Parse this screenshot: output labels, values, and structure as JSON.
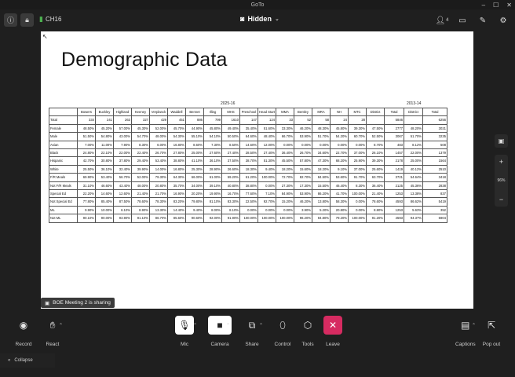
{
  "window": {
    "title": "GoTo",
    "controls": [
      "–",
      "☐",
      "✕"
    ]
  },
  "topbar": {
    "connection": "CH16",
    "view_mode": "Hidden",
    "attendees_count": "4"
  },
  "slide": {
    "title": "Demographic Data",
    "group_left": "2025-16",
    "group_right": "2013-14",
    "header": [
      "",
      "Bowers",
      "Buckley",
      "Highland",
      "Keeney",
      "Verplanck",
      "Waddell",
      "Bennet",
      "Illing",
      "MHS",
      "Preschool",
      "Head Start",
      "MMA",
      "Bentley",
      "MRA",
      "NH",
      "MTC",
      "District",
      "Total",
      "District",
      "Total"
    ],
    "rows": [
      [
        "Total",
        "334",
        "241",
        "263",
        "327",
        "429",
        "451",
        "886",
        "799",
        "1610",
        "147",
        "124",
        "33",
        "52",
        "58",
        "24",
        "28",
        "",
        "5846",
        "",
        "6256"
      ],
      [
        "Female",
        "48.50%",
        "45.20%",
        "57.00%",
        "45.30%",
        "52.00%",
        "45.70%",
        "44.90%",
        "45.80%",
        "49.40%",
        "35.40%",
        "51.60%",
        "33.30%",
        "46.20%",
        "48.30%",
        "45.80%",
        "39.30%",
        "47.50%",
        "2777",
        "48.20%",
        "3021"
      ],
      [
        "Male",
        "51.50%",
        "54.80%",
        "43.00%",
        "54.70%",
        "48.00%",
        "54.30%",
        "55.10%",
        "54.10%",
        "50.50%",
        "64.60%",
        "48.40%",
        "66.70%",
        "53.90%",
        "51.70%",
        "54.20%",
        "60.70%",
        "52.50%",
        "3067",
        "51.70%",
        "3235"
      ],
      [
        "Asian",
        "7.00%",
        "11.00%",
        "7.90%",
        "8.30%",
        "6.00%",
        "16.80%",
        "8.60%",
        "7.30%",
        "8.50%",
        "14.60%",
        "12.00%",
        "0.00%",
        "0.00%",
        "0.00%",
        "0.00%",
        "0.00%",
        "8.70%",
        "483",
        "8.12%",
        "508"
      ],
      [
        "Black",
        "24.80%",
        "22.10%",
        "22.00%",
        "22.40%",
        "26.70%",
        "27.80%",
        "25.00%",
        "27.60%",
        "27.40%",
        "28.50%",
        "27.40%",
        "36.40%",
        "26.70%",
        "34.60%",
        "22.70%",
        "37.00%",
        "26.10%",
        "1457",
        "22.00%",
        "1379"
      ],
      [
        "Hispanic",
        "42.70%",
        "30.80%",
        "37.80%",
        "29.40%",
        "53.40%",
        "38.80%",
        "41.10%",
        "36.10%",
        "37.50%",
        "38.70%",
        "51.30%",
        "45.50%",
        "57.80%",
        "47.30%",
        "68.20%",
        "25.90%",
        "39.30%",
        "2178",
        "25.00%",
        "1564"
      ],
      [
        "White",
        "25.50%",
        "36.10%",
        "32.40%",
        "39.90%",
        "14.00%",
        "16.80%",
        "25.30%",
        "28.90%",
        "26.60%",
        "18.30%",
        "9.40%",
        "18.20%",
        "15.60%",
        "18.20%",
        "9.10%",
        "37.00%",
        "25.60%",
        "1419",
        "40.12%",
        "2510"
      ],
      [
        "F/R Meals",
        "69.90%",
        "53.40%",
        "56.70%",
        "52.00%",
        "79.30%",
        "64.30%",
        "66.00%",
        "61.00%",
        "59.20%",
        "61.20%",
        "100.00%",
        "72.70%",
        "82.70%",
        "84.50%",
        "53.60%",
        "91.70%",
        "63.70%",
        "3721",
        "54.64%",
        "3418"
      ],
      [
        "Not F/R Meals",
        "31.10%",
        "46.60%",
        "43.40%",
        "48.00%",
        "20.80%",
        "35.70%",
        "34.00%",
        "39.10%",
        "40.80%",
        "38.80%",
        "0.00%",
        "27.30%",
        "17.30%",
        "15.50%",
        "46.40%",
        "8.30%",
        "36.40%",
        "2125",
        "45.36%",
        "2838"
      ],
      [
        "Special Ed",
        "22.20%",
        "14.60%",
        "12.60%",
        "21.40%",
        "21.70%",
        "16.90%",
        "20.20%",
        "19.90%",
        "16.70%",
        "77.60%",
        "7.10%",
        "84.90%",
        "53.90%",
        "86.20%",
        "41.70%",
        "100.00%",
        "21.40%",
        "1253",
        "13.38%",
        "837"
      ],
      [
        "Not Special Ed",
        "77.80%",
        "85.40%",
        "87.50%",
        "78.60%",
        "78.30%",
        "83.20%",
        "79.80%",
        "81.10%",
        "83.30%",
        "22.50%",
        "92.70%",
        "15.20%",
        "46.20%",
        "13.80%",
        "58.30%",
        "0.00%",
        "78.60%",
        "4593",
        "86.62%",
        "5419"
      ],
      [
        "ML",
        "9.90%",
        "10.00%",
        "6.10%",
        "8.90%",
        "13.30%",
        "14.40%",
        "9.40%",
        "8.00%",
        "8.10%",
        "0.00%",
        "0.00%",
        "0.00%",
        "3.90%",
        "5.20%",
        "20.80%",
        "0.00%",
        "8.80%",
        "1253",
        "5.63%",
        "352"
      ],
      [
        "Not ML",
        "90.10%",
        "90.00%",
        "93.90%",
        "91.10%",
        "86.70%",
        "85.60%",
        "90.60%",
        "92.00%",
        "91.90%",
        "100.00%",
        "100.00%",
        "100.00%",
        "96.20%",
        "94.80%",
        "79.20%",
        "100.00%",
        "91.20%",
        "4593",
        "94.37%",
        "5904"
      ]
    ]
  },
  "sharing": {
    "text": "BOE Meeting 2 is sharing"
  },
  "zoom": {
    "level": "96%"
  },
  "controls": {
    "record": "Record",
    "react": "React",
    "mic": "Mic",
    "camera": "Camera",
    "share": "Share",
    "control": "Control",
    "tools": "Tools",
    "leave": "Leave",
    "captions": "Captions",
    "popout": "Pop out",
    "collapse": "Collapse"
  },
  "colors": {
    "leave": "#d62b61",
    "bar": "#1f1f1f",
    "signal": "#4caf50"
  }
}
